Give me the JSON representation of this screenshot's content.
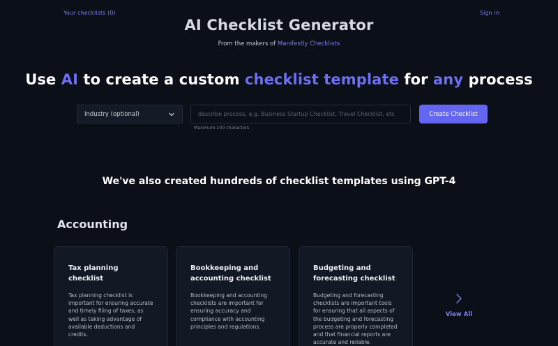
{
  "header": {
    "your_checklists": "Your checklists (0)",
    "sign_in": "Sign in",
    "title": "AI Checklist Generator",
    "makers_prefix": "From the makers of",
    "makers_link": "Manifestly Checklists"
  },
  "hero": {
    "w1": "Use",
    "w2": "AI",
    "w3": "to create a custom",
    "w4": "checklist template",
    "w5": "for",
    "w6": "any",
    "w7": "process"
  },
  "form": {
    "industry_label": "Industry (optional)",
    "description_placeholder": "describe process, e.g. Business Startup Checklist, Travel Checklist, etc",
    "description_value": "",
    "hint": "Maximum 100 characters",
    "create_label": "Create Checklist"
  },
  "templates_heading": "We've also created hundreds of checklist templates using GPT-4",
  "section": {
    "title": "Accounting",
    "cards": [
      {
        "title": "Tax planning checklist",
        "description": "Tax planning checklist is important for ensuring accurate and timely filing of taxes, as well as taking advantage of available deductions and credits."
      },
      {
        "title": "Bookkeeping and accounting checklist",
        "description": "Bookkeeping and accounting checklists are important for ensuring accuracy and compliance with accounting principles and regulations."
      },
      {
        "title": "Budgeting and forecasting checklist",
        "description": "Budgeting and forecasting checklists are important tools for ensuring that all aspects of the budgeting and forecasting process are properly completed and that financial reports are accurate and reliable."
      }
    ],
    "view_all": "View All"
  },
  "colors": {
    "background": "#0b0f17",
    "accent": "#6466f1",
    "link": "#7b7ff0",
    "card": "#121824"
  },
  "icons": {
    "industry_dropdown": "chevron-down-icon",
    "view_all": "chevron-right-icon"
  }
}
